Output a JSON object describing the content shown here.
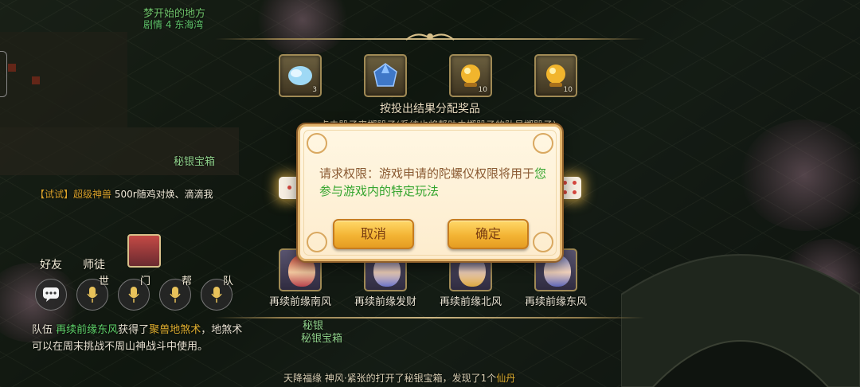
{
  "quest": {
    "title": "梦开始的地方",
    "subtitle": "剧情 4 东海湾"
  },
  "reward_panel": {
    "title": "按投出结果分配奖品",
    "hint": "点击骰子来掷骰子(系统也将帮助未掷骰子的队员掷骰子)",
    "rewards": [
      {
        "icon": "cloud-crystal-icon",
        "count": "3"
      },
      {
        "icon": "blue-ore-icon",
        "count": ""
      },
      {
        "icon": "gold-orb-icon",
        "count": "10"
      },
      {
        "icon": "gold-orb-icon",
        "count": "10"
      }
    ],
    "teammates": [
      {
        "name": "再续前缘南风"
      },
      {
        "name": "再续前缘发财"
      },
      {
        "name": "再续前缘北风"
      },
      {
        "name": "再续前缘东风"
      }
    ]
  },
  "chat": {
    "message_prefix": "【试试】",
    "message_highlight": "超级神兽",
    "message_rest": " 500r随鸡对焕、滴滴我"
  },
  "social": {
    "friends_label": "好友",
    "master_label": "师徒",
    "channels": [
      {
        "label": "世"
      },
      {
        "label": "门"
      },
      {
        "label": "帮"
      },
      {
        "label": "队"
      }
    ]
  },
  "team_log": {
    "tag": "队伍",
    "player": "再续前缘东风",
    "verb": "获得了",
    "item": "聚兽地煞术",
    "rest": "，地煞术可以在周末挑战不周山神战斗中使用。"
  },
  "map_labels": {
    "treasure_top": "秘银宝箱",
    "treasure_bottom_top": "秘银",
    "treasure_bottom": "秘银宝箱"
  },
  "bottom_news": {
    "source": "天降福缘",
    "text": "神风·紧张的打开了秘银宝箱，发现了1个",
    "item": "仙丹"
  },
  "dialog": {
    "text_prefix": "请求权限：游戏申请的陀螺仪权限将用于",
    "text_highlight": "您参与游戏内的特定玩法",
    "cancel_label": "取消",
    "confirm_label": "确定"
  },
  "colors": {
    "dialog_text": "#8a5a32",
    "dialog_highlight": "#35a52f",
    "button_gold": "#f3b434",
    "quest_green": "#6fc36a"
  }
}
